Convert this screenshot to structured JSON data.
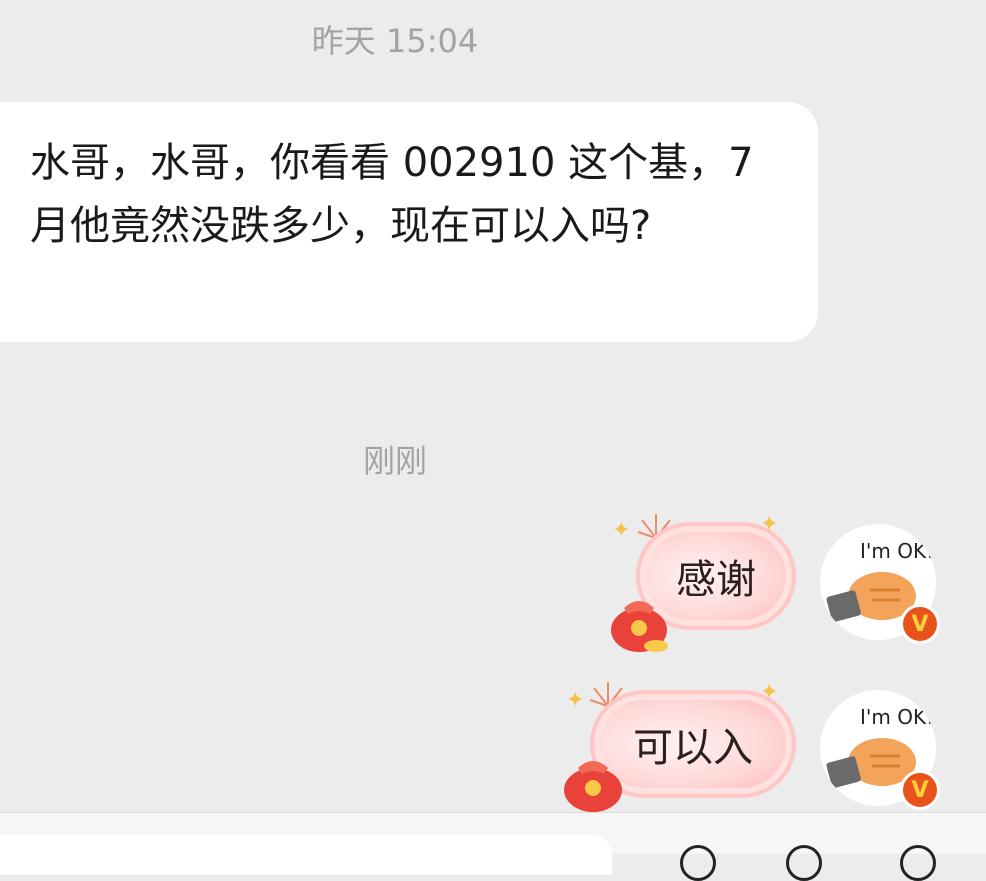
{
  "messages": {
    "timestamp_1": "昨天 15:04",
    "incoming_text": "水哥，水哥，你看看 002910 这个基，7月他竟然没跌多少，现在可以入吗?",
    "timestamp_2": "刚刚",
    "outgoing": [
      {
        "text": "感谢",
        "avatar_icon": "cat-laptop-avatar-icon",
        "avatar_caption": "I'm OK!",
        "badge": "V"
      },
      {
        "text": "可以入",
        "avatar_icon": "cat-laptop-avatar-icon",
        "avatar_caption": "I'm OK!",
        "badge": "V"
      }
    ]
  },
  "icons": [
    "red-lucky-bag-icon",
    "firework-sparkle-icon",
    "star-sparkle-icon",
    "verified-badge-icon"
  ],
  "colors": {
    "background": "#ececec",
    "bubble_in": "#ffffff",
    "bubble_out": "#ffd8d8",
    "badge": "#e8531c",
    "timestamp": "#a3a3a3"
  }
}
